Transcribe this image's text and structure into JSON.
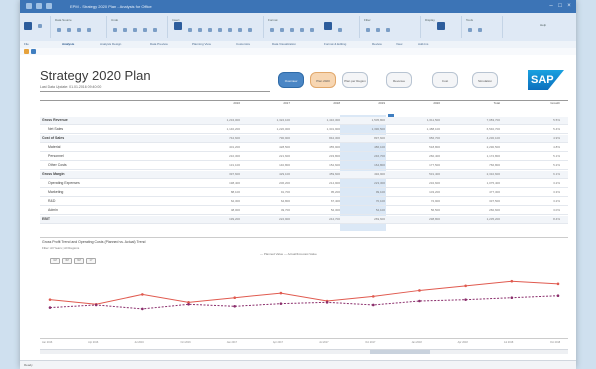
{
  "window": {
    "title": "EPM - Strategy 2020 Plan - Analysis for Office",
    "controls": [
      "–",
      "□",
      "×"
    ]
  },
  "ribbon": {
    "groups": [
      "File",
      "Data Source",
      "Undo",
      "Insert",
      "Format",
      "Filter",
      "Display",
      "Tools",
      "Settings",
      "Help"
    ]
  },
  "tabs": [
    "File",
    "Analysis",
    "Analysis Design",
    "Data Preview",
    "Planning View",
    "Customize",
    "Data Visualization",
    "Format & Editing",
    "Review",
    "View",
    "Add-Ins"
  ],
  "active_tab": "Analysis",
  "page": {
    "title": "Strategy 2020 Plan",
    "subtitle": "Last Data Update: 01.01.2016 09:40:00"
  },
  "nav_buttons": [
    {
      "label": "Overview",
      "state": "active"
    },
    {
      "label": "Plan 2020",
      "state": "alt"
    },
    {
      "label": "Plan per Region",
      "state": "normal"
    },
    {
      "label": "Revenue",
      "state": "normal"
    },
    {
      "label": "Cost",
      "state": "normal"
    },
    {
      "label": "Simulation",
      "state": "normal"
    }
  ],
  "brand": {
    "logo": "SAP",
    "logo_color": "#0b6fbd"
  },
  "table": {
    "column_headers": [
      "",
      "2016",
      "2017",
      "2018",
      "2019",
      "2020",
      "Total",
      "Growth"
    ],
    "rows": [
      {
        "label": "Gross Revenue",
        "style": "bold",
        "values": [
          "1,234,000",
          "1,322,100",
          "1,410,300",
          "1,505,800",
          "1,611,500",
          "7,083,700",
          "5.5%"
        ]
      },
      {
        "label": "Net Sales",
        "style": "normal",
        "values": [
          "1,140,200",
          "1,220,000",
          "1,301,900",
          "1,390,500",
          "1,488,100",
          "6,540,700",
          "5.4%"
        ]
      },
      {
        "label": "Cost of Sales",
        "style": "bold",
        "values": [
          "742,600",
          "790,900",
          "842,300",
          "897,600",
          "956,700",
          "4,230,100",
          "4.9%"
        ]
      },
      {
        "label": "Material",
        "style": "normal",
        "values": [
          "401,200",
          "428,500",
          "455,900",
          "486,100",
          "518,800",
          "2,290,500",
          "4.8%"
        ]
      },
      {
        "label": "Personnel",
        "style": "normal",
        "values": [
          "210,300",
          "221,600",
          "233,800",
          "246,700",
          "260,400",
          "1,172,800",
          "5.1%"
        ]
      },
      {
        "label": "Other Costs",
        "style": "normal",
        "values": [
          "131,100",
          "140,800",
          "152,600",
          "164,800",
          "177,500",
          "766,800",
          "5.2%"
        ]
      },
      {
        "label": "Gross Margin",
        "style": "bold",
        "values": [
          "397,600",
          "429,100",
          "459,600",
          "492,900",
          "531,400",
          "2,310,600",
          "6.1%"
        ]
      },
      {
        "label": "Operating Expenses",
        "style": "normal",
        "values": [
          "198,400",
          "206,200",
          "214,900",
          "223,300",
          "232,600",
          "1,075,400",
          "3.2%"
        ]
      },
      {
        "label": "Marketing",
        "style": "normal",
        "values": [
          "88,100",
          "91,700",
          "95,200",
          "99,100",
          "103,200",
          "477,300",
          "3.3%"
        ]
      },
      {
        "label": "R&D",
        "style": "normal",
        "values": [
          "62,300",
          "64,800",
          "67,400",
          "70,100",
          "72,900",
          "337,500",
          "3.2%"
        ]
      },
      {
        "label": "Admin",
        "style": "normal",
        "values": [
          "48,000",
          "49,700",
          "52,300",
          "54,100",
          "56,500",
          "260,600",
          "3.0%"
        ]
      },
      {
        "label": "EBIT",
        "style": "bold",
        "values": [
          "199,200",
          "222,900",
          "244,700",
          "269,600",
          "298,800",
          "1,235,200",
          "8.4%"
        ]
      }
    ]
  },
  "chart": {
    "title": "Gross Profit Trend and Operating Costs (Planned vs. Actual) Trend",
    "subtitle": "Filter: All Years | All Regions",
    "legend": "— Planned Value    — Actual/Forecast Value",
    "period_buttons": [
      "1M",
      "3M",
      "6M",
      "1Y"
    ],
    "months": [
      "Jan 2016",
      "Apr 2016",
      "Jul 2016",
      "Oct 2016",
      "Jan 2017",
      "Apr 2017",
      "Jul 2017",
      "Oct 2017",
      "Jan 2018",
      "Apr 2018",
      "Jul 2018",
      "Oct 2018"
    ]
  },
  "chart_data": {
    "type": "line",
    "title": "",
    "x": [
      "Jan 2016",
      "Apr 2016",
      "Jul 2016",
      "Oct 2016",
      "Jan 2017",
      "Apr 2017",
      "Jul 2017",
      "Oct 2017",
      "Jan 2018",
      "Apr 2018",
      "Jul 2018",
      "Oct 2018"
    ],
    "series": [
      {
        "values": [
          52,
          45,
          60,
          48,
          55,
          62,
          50,
          57,
          66,
          73,
          80,
          76
        ],
        "color": "#e05a4f"
      },
      {
        "values": [
          40,
          44,
          38,
          45,
          42,
          46,
          48,
          44,
          50,
          52,
          55,
          58
        ],
        "color": "#8a2d6b"
      }
    ],
    "ylim": [
      0,
      100
    ],
    "grid": false,
    "legend_position": "top-center"
  },
  "status": {
    "text": "Ready"
  }
}
